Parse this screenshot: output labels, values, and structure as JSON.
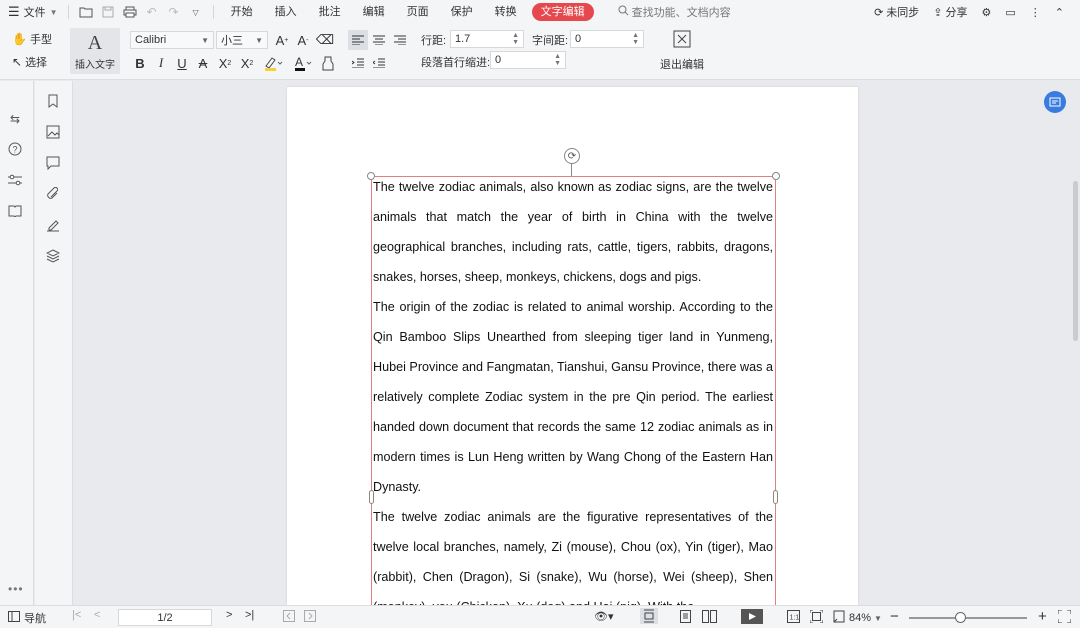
{
  "menubar": {
    "file_label": "文件",
    "tabs": [
      {
        "label": "开始",
        "active": false
      },
      {
        "label": "插入",
        "active": false
      },
      {
        "label": "批注",
        "active": false
      },
      {
        "label": "编辑",
        "active": false
      },
      {
        "label": "页面",
        "active": false
      },
      {
        "label": "保护",
        "active": false
      },
      {
        "label": "转换",
        "active": false
      },
      {
        "label": "文字编辑",
        "active": true
      }
    ],
    "search_label": "查找功能、文档内容",
    "unsynced_label": "未同步",
    "share_label": "分享"
  },
  "ribbon": {
    "hand_label": "手型",
    "select_label": "选择",
    "insert_text_label": "插入文字",
    "insert_text_glyph": "A",
    "font_family": "Calibri",
    "font_size": "小三",
    "line_spacing_label": "行距:",
    "line_spacing_value": "1.7",
    "char_spacing_label": "字间距:",
    "char_spacing_value": "0",
    "first_indent_label": "段落首行缩进:",
    "first_indent_value": "0",
    "exit_edit_label": "退出编辑"
  },
  "document": {
    "paragraphs": [
      "The twelve zodiac animals, also known as zodiac signs, are the twelve animals that match the year of birth in China with the twelve geographical branches, including rats, cattle, tigers, rabbits, dragons, snakes, horses, sheep, monkeys, chickens, dogs and pigs.",
      "The origin of the zodiac is related to animal worship. According to the Qin Bamboo Slips Unearthed from sleeping tiger land in Yunmeng, Hubei Province and Fangmatan, Tianshui, Gansu Province, there was a relatively complete Zodiac system in the pre Qin period. The earliest handed down document that records the same 12 zodiac animals as in modern times is Lun Heng written by Wang Chong of the Eastern Han Dynasty.",
      "The twelve zodiac animals are the figurative representatives of the twelve local branches, namely, Zi (mouse), Chou (ox), Yin (tiger), Mao (rabbit), Chen (Dragon), Si (snake), Wu (horse), Wei (sheep), Shen (monkey), you (Chicken), Xu (dog) and Hai (pig). With the"
    ]
  },
  "statusbar": {
    "nav_label": "导航",
    "page_indicator": "1/2",
    "zoom_label": "84%",
    "zoom_level_percent": 84
  },
  "colors": {
    "accent": "#e5484d",
    "textbox_border": "#e0807f",
    "float_button": "#3a7be0"
  }
}
